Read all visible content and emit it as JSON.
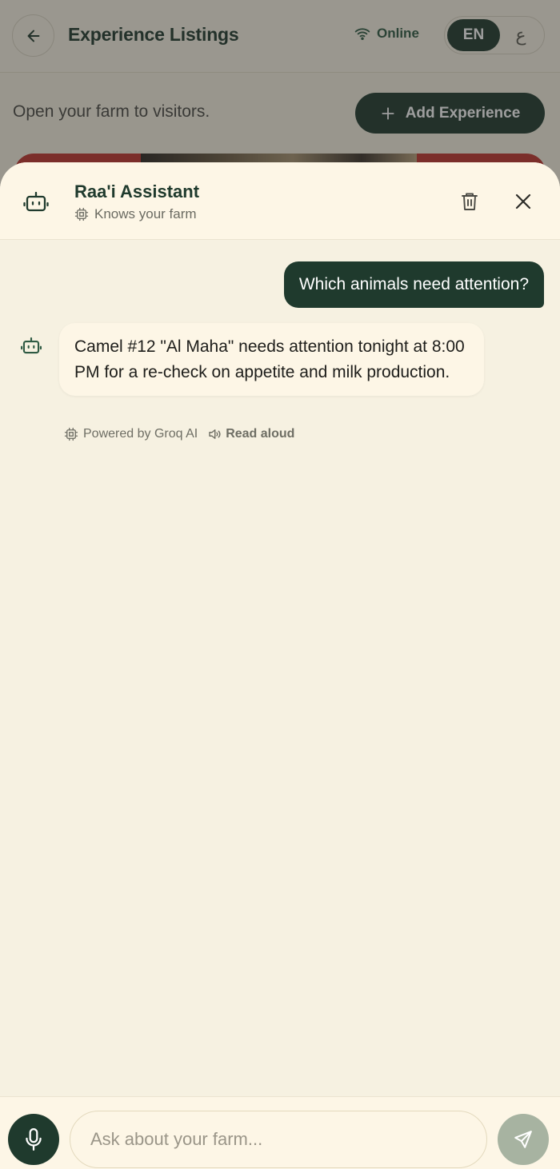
{
  "page": {
    "title": "Experience Listings",
    "status": "Online",
    "lang": {
      "active": "EN",
      "other": "ع"
    },
    "subtitle": "Open your farm to visitors.",
    "add_button": "Add Experience"
  },
  "chat": {
    "assistant_name": "Raa'i Assistant",
    "assistant_subtitle": "Knows your farm",
    "messages": [
      {
        "role": "user",
        "text": "Which animals need attention?"
      },
      {
        "role": "assistant",
        "text": "Camel #12 \"Al Maha\" needs attention tonight at 8:00 PM for a re-check on appetite and milk production."
      }
    ],
    "powered_by": "Powered by Groq AI",
    "read_aloud": "Read aloud",
    "input_placeholder": "Ask about your farm..."
  },
  "colors": {
    "primary": "#1f3a2d",
    "background": "#f6f1e1",
    "surface": "#fdf6e6",
    "send_disabled": "#a7b3a1"
  },
  "icons": {
    "back": "arrow-left-icon",
    "status": "wifi-icon",
    "add": "plus-icon",
    "assistant": "robot-icon",
    "chip": "cpu-chip-icon",
    "delete": "trash-icon",
    "close": "close-icon",
    "speaker": "speaker-icon",
    "mic": "microphone-icon",
    "send": "send-icon"
  }
}
